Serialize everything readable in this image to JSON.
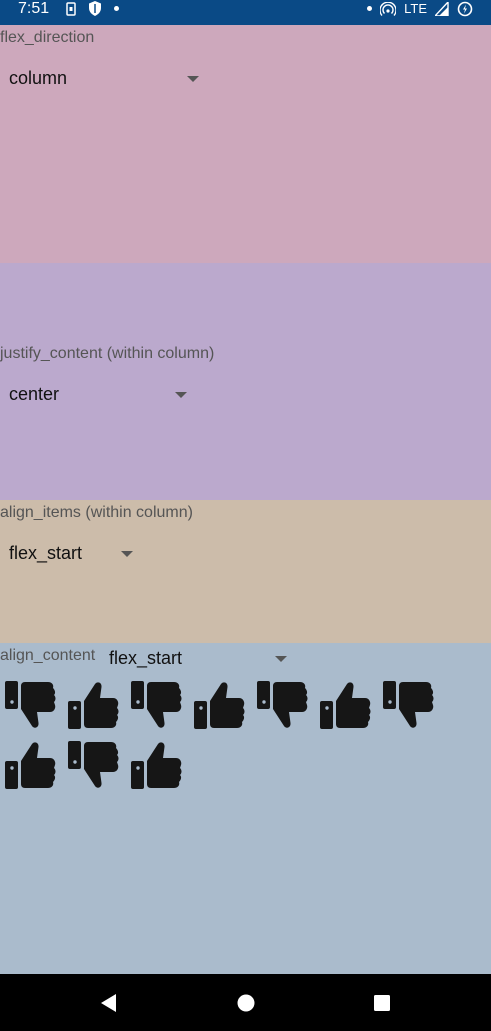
{
  "status_bar": {
    "time": "7:51",
    "network": "LTE",
    "icons_left": [
      "sim-icon",
      "shield-icon",
      "dot-icon"
    ],
    "icons_right": [
      "dot-icon",
      "hotspot-icon",
      "signal-icon",
      "battery-saver-icon"
    ]
  },
  "flex_direction": {
    "label": "flex_direction",
    "value": "column"
  },
  "justify_content": {
    "label": "justify_content  (within column)",
    "value": "center"
  },
  "align_items": {
    "label": "align_items (within column)",
    "value": "flex_start"
  },
  "align_content": {
    "label": "align_content",
    "value": "flex_start",
    "icons": [
      "thumbs-down",
      "thumbs-up",
      "thumbs-down",
      "thumbs-up",
      "thumbs-down",
      "thumbs-up",
      "thumbs-down",
      "thumbs-up",
      "thumbs-down",
      "thumbs-up"
    ]
  },
  "nav_bar": {
    "buttons": [
      "back-icon",
      "home-icon",
      "recents-icon"
    ]
  },
  "colors": {
    "status_bar": "#0a4a86",
    "flex_direction_bg": "#cda8bc",
    "justify_content_bg": "#bba9cd",
    "align_items_bg": "#ccbcaa",
    "align_content_bg": "#aabbcc",
    "nav_bar": "#000000"
  }
}
